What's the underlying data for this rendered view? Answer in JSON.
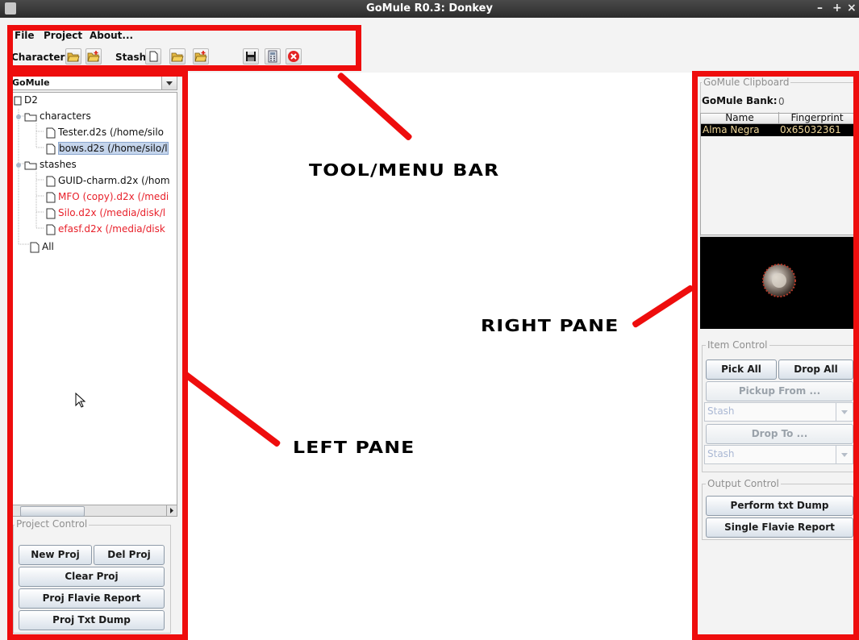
{
  "window": {
    "title": "GoMule R0.3: Donkey",
    "controls": [
      "–",
      "+",
      "×"
    ]
  },
  "menu": {
    "items": [
      "File",
      "Project",
      "About..."
    ]
  },
  "toolbar": {
    "character_label": "Character",
    "stash_label": "Stash"
  },
  "left": {
    "combo_value": "GoMule",
    "tree": [
      {
        "label": "D2",
        "kind": "root",
        "color": "normal"
      },
      {
        "label": "characters",
        "kind": "folder",
        "color": "normal"
      },
      {
        "label": "Tester.d2s (/home/silo",
        "kind": "file",
        "color": "normal"
      },
      {
        "label": "bows.d2s (/home/silo/l",
        "kind": "file",
        "color": "selected"
      },
      {
        "label": "stashes",
        "kind": "folder",
        "color": "normal"
      },
      {
        "label": "GUID-charm.d2x (/hom",
        "kind": "file",
        "color": "normal"
      },
      {
        "label": "MFO (copy).d2x (/medi",
        "kind": "file",
        "color": "red"
      },
      {
        "label": "Silo.d2x (/media/disk/l",
        "kind": "file",
        "color": "red"
      },
      {
        "label": "efasf.d2x (/media/disk",
        "kind": "file",
        "color": "red"
      },
      {
        "label": "All",
        "kind": "file",
        "color": "normal"
      }
    ],
    "project_control": {
      "title": "Project Control",
      "new_proj": "New Proj",
      "del_proj": "Del Proj",
      "clear_proj": "Clear Proj",
      "flavie": "Proj Flavie Report",
      "txt_dump": "Proj Txt Dump"
    }
  },
  "right": {
    "clipboard_title": "GoMule Clipboard",
    "bank_label": "GoMule Bank:",
    "bank_value": "0",
    "columns": [
      "Name",
      "Fingerprint"
    ],
    "rows": [
      [
        "Alma Negra",
        "0x65032361"
      ]
    ],
    "item_control": {
      "title": "Item Control",
      "pick_all": "Pick All",
      "drop_all": "Drop All",
      "pickup_from": "Pickup From ...",
      "pickup_select": "Stash",
      "drop_to": "Drop To ...",
      "drop_select": "Stash"
    },
    "output_control": {
      "title": "Output Control",
      "txt_dump": "Perform txt Dump",
      "flavie": "Single Flavie Report"
    }
  },
  "annotations": {
    "toolbar": "TOOL/MENU BAR",
    "right": "RIGHT PANE",
    "left": "LEFT PANE"
  },
  "colors": {
    "annotation_red": "#ee0d0d",
    "selection": "#c5d5ec",
    "missing_file_red": "#e8202a"
  }
}
